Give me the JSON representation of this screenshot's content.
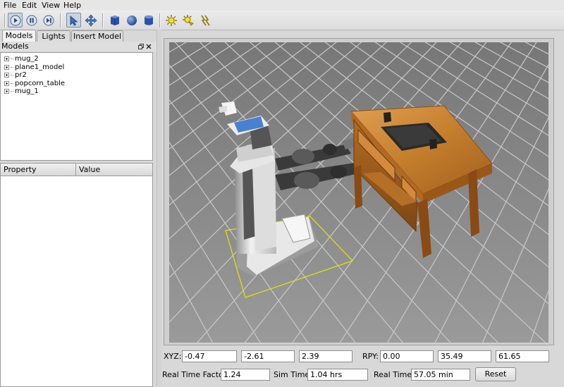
{
  "menu": {
    "file": "File",
    "edit": "Edit",
    "view": "View",
    "help": "Help"
  },
  "toolbar": {
    "icons": [
      "play-icon",
      "pause-icon",
      "step-icon",
      "select-arrow-icon",
      "translate-icon",
      "box-icon",
      "sphere-icon",
      "cylinder-icon",
      "point-light-icon",
      "spot-light-icon",
      "directional-light-icon"
    ]
  },
  "tabs": [
    "Models",
    "Lights",
    "Insert Model"
  ],
  "panel": {
    "title": "Models",
    "tree": [
      "mug_2",
      "plane1_model",
      "pr2",
      "popcorn_table",
      "mug_1"
    ],
    "property_columns": [
      "Property",
      "Value"
    ]
  },
  "status": {
    "xyz_label": "XYZ:",
    "xyz": [
      "-0.47",
      "-2.61",
      "2.39"
    ],
    "rpy_label": "RPY:",
    "rpy": [
      "0.00",
      "35.49",
      "61.65"
    ],
    "rtf_label": "Real Time Factor:",
    "rtf": "1.24",
    "sim_label": "Sim Time:",
    "sim": "1.04 hrs",
    "real_label": "Real Time:",
    "real": "57.05 min",
    "reset": "Reset"
  },
  "colors": {
    "ground": "#8f8f8f",
    "grid": "#c8c8c8",
    "table": "#c47e2c",
    "selection": "#e6e600"
  }
}
